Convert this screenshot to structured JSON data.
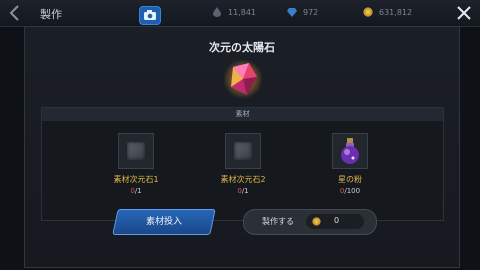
{
  "header": {
    "title": "製作",
    "currencies": [
      {
        "icon": "drop-icon",
        "value": "11,841"
      },
      {
        "icon": "gem-icon",
        "value": "972"
      },
      {
        "icon": "gold-coin-icon",
        "value": "631,812"
      }
    ]
  },
  "dialog": {
    "title": "次元の太陽石",
    "item_icon": "crystal-icon",
    "materials_label": "素材",
    "materials": [
      {
        "name": "素材次元石1",
        "current": "0",
        "required": "/1",
        "icon": "cube-icon"
      },
      {
        "name": "素材次元石2",
        "current": "0",
        "required": "/1",
        "icon": "cube-icon"
      },
      {
        "name": "星の粉",
        "current": "0",
        "required": "/100",
        "icon": "potion-icon"
      }
    ],
    "input_button": "素材投入",
    "craft_button": "製作する",
    "craft_cost": "0"
  },
  "colors": {
    "accent_blue": "#2767b8",
    "shortfall_red": "#e05252",
    "material_name": "#e0b64a"
  }
}
